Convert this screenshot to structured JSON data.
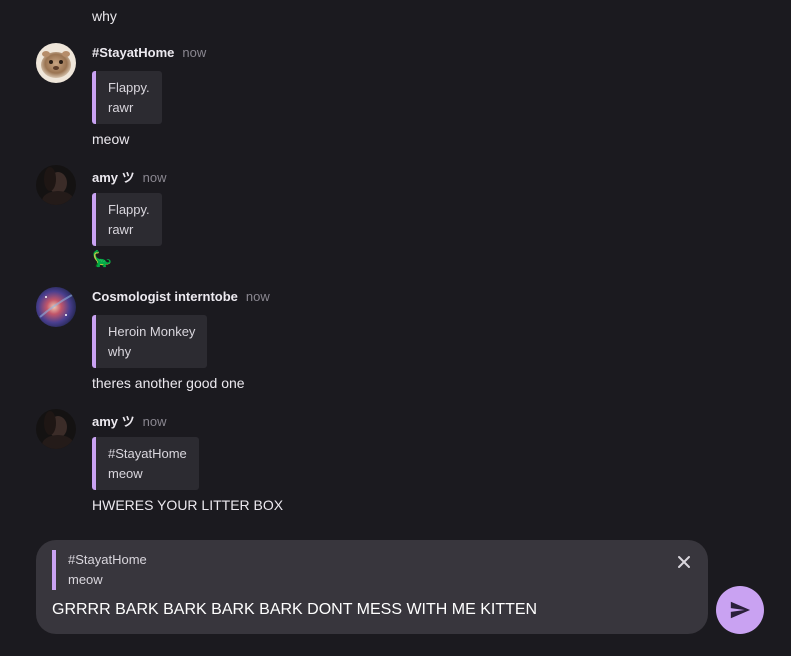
{
  "chat": {
    "continuation_text": "why",
    "messages": [
      {
        "author": "#StayatHome",
        "time": "now",
        "reply": {
          "author": "Flappy.",
          "text": "rawr"
        },
        "text": "meow",
        "avatar_icon": "hamster-avatar"
      },
      {
        "author": "amy ツ",
        "time": "now",
        "reply": {
          "author": "Flappy.",
          "text": "rawr"
        },
        "text": "🦕",
        "avatar_icon": "dark-portrait-avatar"
      },
      {
        "author": "Cosmologist interntobe",
        "time": "now",
        "reply": {
          "author": "Heroin Monkey",
          "text": "why"
        },
        "text": "theres another good one",
        "avatar_icon": "nebula-avatar"
      },
      {
        "author": "amy ツ",
        "time": "now",
        "reply": {
          "author": "#StayatHome",
          "text": "meow"
        },
        "text": "HWERES YOUR LITTER BOX",
        "avatar_icon": "dark-portrait-avatar"
      }
    ]
  },
  "composer": {
    "reply_author": "#StayatHome",
    "reply_text": "meow",
    "input_value": "GRRRR BARK BARK BARK BARK DONT MESS WITH ME KITTEN",
    "close_icon": "close-icon",
    "send_icon": "send-icon"
  },
  "colors": {
    "background": "#1b1a1f",
    "accent": "#c9a2f2",
    "quote_background": "#2c2b31",
    "composer_background": "#38363d",
    "muted_text": "#8a8790"
  }
}
